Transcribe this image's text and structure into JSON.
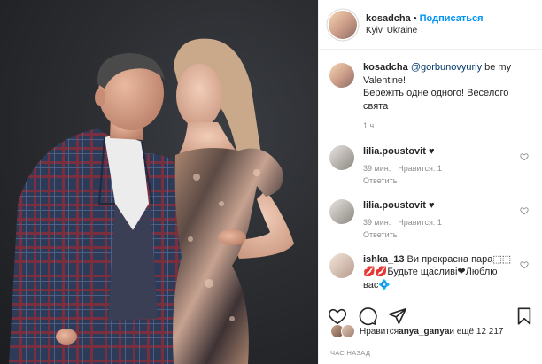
{
  "post": {
    "author": "kosadcha",
    "follow_label": "Подписаться",
    "separator": "•",
    "location": "Kyiv, Ukraine"
  },
  "caption": {
    "username": "kosadcha",
    "mention": "@gorbunovyuriy",
    "text_after_mention": " be my Valentine!",
    "text_line2": "Бережіть одне одного! Веселого свята",
    "time": "1 ч."
  },
  "comments": [
    {
      "username": "lilia.poustovit",
      "text": "♥",
      "time": "39 мин.",
      "likes": "Нравится: 1",
      "reply": "Ответить"
    },
    {
      "username": "lilia.poustovit",
      "text": "♥",
      "time": "39 мин.",
      "likes": "Нравится: 1",
      "reply": "Ответить"
    },
    {
      "username": "ishka_13",
      "text": "Ви прекрасна пара⬚⬚ 💋💋Будьте щасливі❤Люблю вас💠",
      "time": "",
      "likes": "",
      "reply": ""
    }
  ],
  "likes_line": {
    "prefix": "Нравится ",
    "user": "anya_ganya",
    "suffix": " и ещё 12 217"
  },
  "timestamp": "ЧАС НАЗАД",
  "icons": [
    "heart-icon",
    "comment-icon",
    "share-icon",
    "bookmark-icon"
  ]
}
